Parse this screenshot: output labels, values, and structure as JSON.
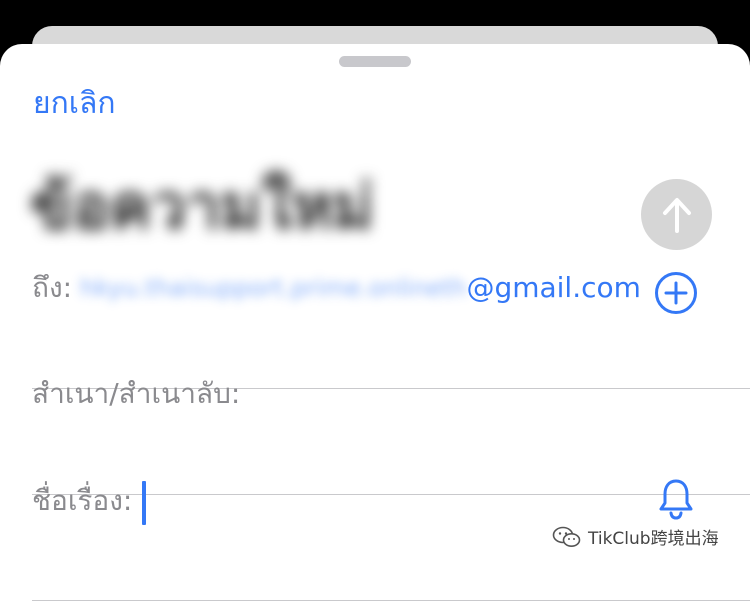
{
  "header": {
    "cancel_label": "ยกเลิก",
    "title": "ข้อความใหม่"
  },
  "compose": {
    "to": {
      "label": "ถึง:",
      "address_redacted": "hkyu.thaisupport.prime.onlineth",
      "address_domain": "@gmail.com"
    },
    "cc_bcc": {
      "label": "สำเนา/สำเนาลับ:"
    },
    "subject": {
      "label": "ชื่อเรื่อง:",
      "value": ""
    }
  },
  "icons": {
    "send": "arrow-up-icon",
    "add": "plus-circle-icon",
    "notify": "bell-icon"
  },
  "watermark": {
    "text": "TikClub跨境出海"
  },
  "colors": {
    "accent": "#3478f6",
    "label": "#8a8a8e",
    "send_disabled": "#d6d6d6",
    "background": "#ffffff"
  }
}
